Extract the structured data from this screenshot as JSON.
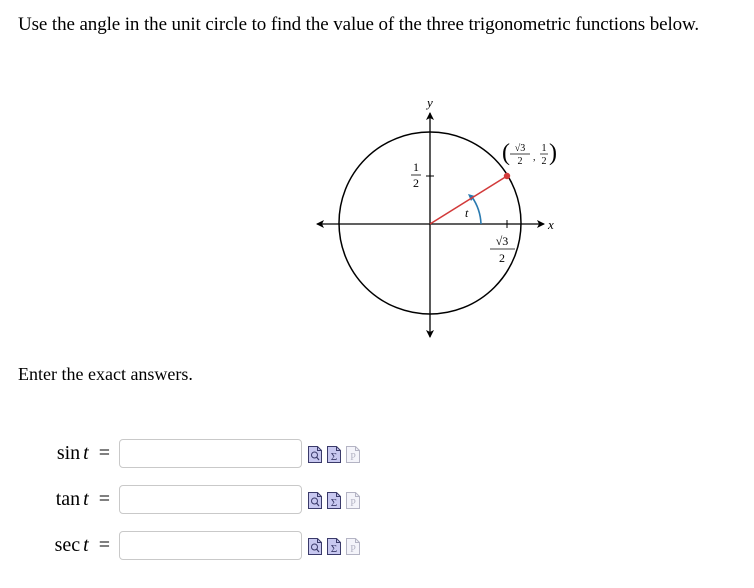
{
  "instruction": "Use the angle in the unit circle to find the value of the three trigonometric functions below.",
  "figure": {
    "axis_labels": {
      "x": "x",
      "y": "y"
    },
    "angle_label": "t",
    "y_tick_label": {
      "numerator": "1",
      "denominator": "2"
    },
    "x_tick_label": {
      "numerator": "√3",
      "denominator": "2"
    },
    "point_label": {
      "x_numerator": "√3",
      "x_denominator": "2",
      "y_numerator": "1",
      "y_denominator": "2"
    },
    "point": {
      "x": "√3/2",
      "y": "1/2"
    },
    "angle_degrees": 30,
    "colors": {
      "radius_line": "#d23a3a",
      "angle_arc": "#2a7ab0",
      "axes": "#000000",
      "circle": "#000000"
    }
  },
  "subtitle": "Enter the exact answers.",
  "answers": [
    {
      "function": "sin",
      "variable": "t",
      "equals": "=",
      "value": "",
      "placeholder": ""
    },
    {
      "function": "tan",
      "variable": "t",
      "equals": "=",
      "value": "",
      "placeholder": ""
    },
    {
      "function": "sec",
      "variable": "t",
      "equals": "=",
      "value": "",
      "placeholder": ""
    }
  ],
  "tool_icons": [
    {
      "name": "preview-icon",
      "enabled": true
    },
    {
      "name": "equation-editor-icon",
      "enabled": true
    },
    {
      "name": "pdf-icon",
      "enabled": false
    }
  ],
  "icon_colors": {
    "enabled_fill": "#c8c8f0",
    "enabled_stroke": "#3a3a6a",
    "disabled_fill": "#f4f4fa",
    "disabled_stroke": "#b4b4c4"
  }
}
